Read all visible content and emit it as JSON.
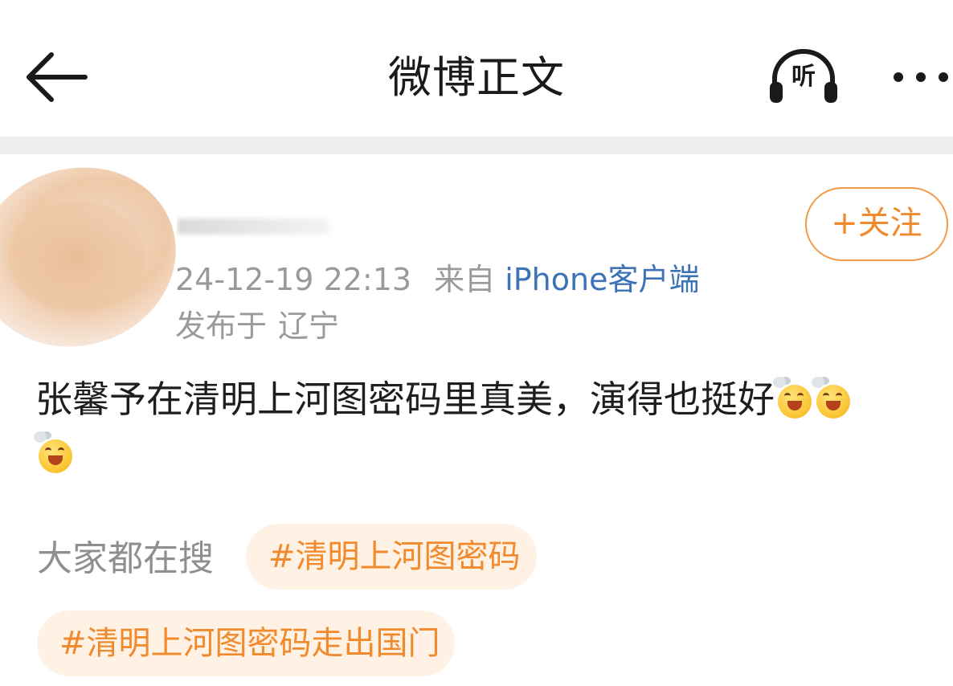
{
  "navbar": {
    "title": "微博正文",
    "listen_label": "听"
  },
  "post": {
    "follow_label": "+关注",
    "timestamp": "24-12-19 22:13",
    "source_prefix": "来自",
    "source_client": "iPhone客户端",
    "location_prefix": "发布于",
    "location": "辽宁",
    "text": "张馨予在清明上河图密码里真美，演得也挺好",
    "emoji_name": "laughing-face-emoji"
  },
  "trending": {
    "label": "大家都在搜",
    "topics": [
      "#清明上河图密码",
      "#清明上河图密码走出国门"
    ]
  },
  "colors": {
    "accent_orange": "#f08a2c",
    "chip_background": "#fff1e4",
    "link_blue": "#3c73b6",
    "meta_gray": "#9a9a9a"
  }
}
